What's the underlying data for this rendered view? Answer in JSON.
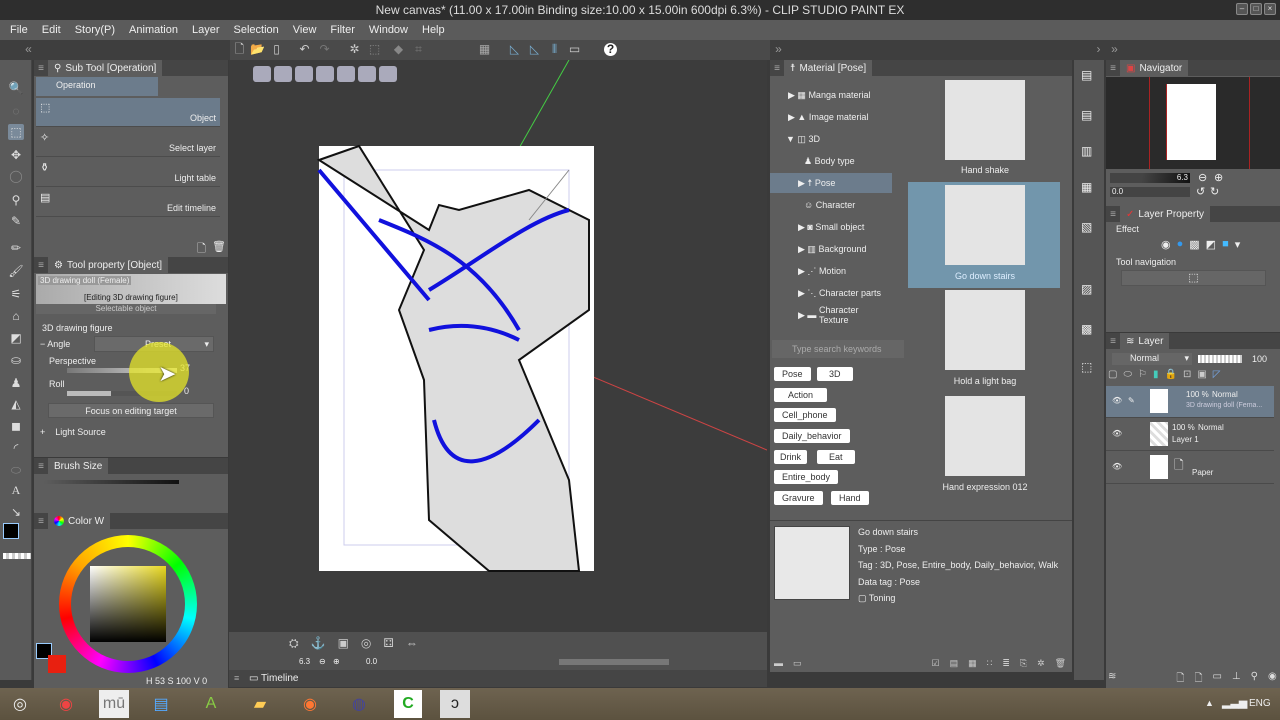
{
  "window": {
    "title": "New canvas* (11.00 x 17.00in Binding size:10.00 x 15.00in 600dpi 6.3%)  - CLIP STUDIO PAINT EX",
    "minimize": "–",
    "maximize": "□",
    "close": "×"
  },
  "menu": [
    "File",
    "Edit",
    "Story(P)",
    "Animation",
    "Layer",
    "Selection",
    "View",
    "Filter",
    "Window",
    "Help"
  ],
  "subtool": {
    "title": "Sub Tool [Operation]",
    "group": "Operation",
    "items": [
      {
        "label": "Object",
        "selected": true
      },
      {
        "label": "Select layer"
      },
      {
        "label": "Light table"
      },
      {
        "label": "Edit timeline"
      }
    ]
  },
  "toolprop": {
    "title": "Tool property [Object]",
    "object_name": "3D drawing doll (Female)",
    "editing": "[Editing 3D drawing figure]",
    "selectable": "Selectable object",
    "section": "3D drawing figure",
    "angle": "Angle",
    "preset": "Preset",
    "perspective_label": "Perspective",
    "perspective_value": "37",
    "roll_label": "Roll",
    "roll_value": "0",
    "focus_button": "Focus on editing target",
    "light_source": "Light Source"
  },
  "brush": {
    "title": "Brush Size"
  },
  "color": {
    "title": "Color W",
    "h": "53",
    "s": "100",
    "v": "0",
    "main_color": "#000000",
    "sub_color": "#e82010"
  },
  "canvas": {
    "zoom": "6.3",
    "rotation": "0.0"
  },
  "timeline": {
    "title": "Timeline"
  },
  "material": {
    "title": "Material [Pose]",
    "tree": [
      {
        "label": "Manga material",
        "level": 0,
        "arrow": "▶"
      },
      {
        "label": "Image material",
        "level": 0,
        "arrow": "▶"
      },
      {
        "label": "3D",
        "level": 0,
        "arrow": "▼"
      },
      {
        "label": "Body type",
        "level": 1,
        "arrow": ""
      },
      {
        "label": "Pose",
        "level": 1,
        "arrow": "▶",
        "selected": true
      },
      {
        "label": "Character",
        "level": 1,
        "arrow": ""
      },
      {
        "label": "Small object",
        "level": 1,
        "arrow": "▶"
      },
      {
        "label": "Background",
        "level": 1,
        "arrow": "▶"
      },
      {
        "label": "Motion",
        "level": 1,
        "arrow": "▶"
      },
      {
        "label": "Character parts",
        "level": 1,
        "arrow": "▶"
      },
      {
        "label": "Character Texture",
        "level": 1,
        "arrow": "▶"
      }
    ],
    "search_placeholder": "Type search keywords",
    "tags": [
      "Pose",
      "3D",
      "Action",
      "Cell_phone",
      "Daily_behavior",
      "Drink",
      "Eat",
      "Entire_body",
      "Gravure",
      "Hand"
    ],
    "thumbnails": [
      {
        "label": "Hand shake"
      },
      {
        "label": "Go down stairs",
        "selected": true
      },
      {
        "label": "Hold a light bag"
      },
      {
        "label": "Hand expression 012"
      }
    ],
    "detail": {
      "name": "Go down stairs",
      "type": "Type : Pose",
      "tag": "Tag : 3D, Pose, Entire_body, Daily_behavior, Walk",
      "data_tag": "Data tag : Pose",
      "toning": "Toning"
    }
  },
  "navigator": {
    "title": "Navigator",
    "zoom": "6.3",
    "rotation": "0.0"
  },
  "layerprop": {
    "title": "Layer Property",
    "effect": "Effect",
    "tool_nav": "Tool navigation"
  },
  "layer": {
    "title": "Layer",
    "blend": "Normal",
    "opacity": "100",
    "rows": [
      {
        "opacity": "100 %",
        "mode": "Normal",
        "name": "3D drawing doll (Fema..."
      },
      {
        "opacity": "100 %",
        "mode": "Normal",
        "name": "Layer 1"
      },
      {
        "name": "Paper"
      }
    ]
  },
  "taskbar": {
    "lang": "ENG"
  }
}
